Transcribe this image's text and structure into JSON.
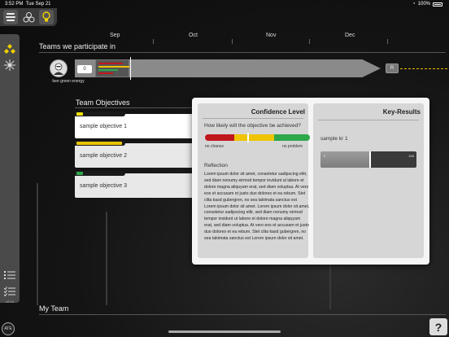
{
  "status_bar": {
    "time": "3:52 PM",
    "date": "Tue Sep 21",
    "battery": "100%"
  },
  "timeline": {
    "months": [
      "Sep",
      "Oct",
      "Nov",
      "Dec"
    ]
  },
  "teams_section": {
    "title": "Teams we participate in",
    "team": {
      "name": "bee green energy",
      "score": "0",
      "end_label": "R"
    }
  },
  "objectives_section": {
    "title": "Team Objectives",
    "objectives": [
      {
        "label": "sample objective 1",
        "color": "#f0e000",
        "selected": true
      },
      {
        "label": "sample objective 2",
        "color": "#e8c400",
        "selected": false
      },
      {
        "label": "sample objective 3",
        "color": "#2ea84a",
        "selected": false
      }
    ]
  },
  "confidence_panel": {
    "title": "Confidence Level",
    "question": "How likely will the objective be achieved?",
    "low_label": "no chance",
    "high_label": "no problem",
    "confidence_level": 0.41,
    "colors": [
      "#c0171d",
      "#f0c400",
      "#2ea84a"
    ],
    "reflection_title": "Reflection",
    "reflection_text": "Lorem ipsum dolor sit amet, consetetur sadipscing elitr, sed diam nonumy eirmod tempor invidunt ut labore et dolore magna aliquyam erat, sed diam voluptua. At vero eos et accusam et justo duo dolores et ea rebum. Stet clita kasd gubergren, no sea takimata sanctus est Lorem ipsum dolor sit amet. Lorem ipsum dolor sit amet, consetetur sadipscing elitr, sed diam nonumy eirmod tempor invidunt ut labore et dolore magna aliquyam erat, sed diam voluptua. At vero eos et accusam et justo duo dolores et ea rebum. Stet clita kasd gubergren, no sea takimata sanctus est Lorem ipsum dolor sit amet."
  },
  "key_results_panel": {
    "title": "Key-Results",
    "results": [
      {
        "name": "sample kr 1",
        "min": "0",
        "max": "100",
        "progress": 0.52
      }
    ]
  },
  "my_team": {
    "title": "My Team"
  },
  "sidebar": {
    "version": "v2.24",
    "ate_label": "ATE"
  },
  "help": {
    "label": "?"
  },
  "icons": [
    "hive-icon",
    "hexagons-icon",
    "bulb-icon",
    "team-hierarchy-icon",
    "network-icon",
    "list-icon",
    "checklist-icon",
    "help-icon"
  ]
}
